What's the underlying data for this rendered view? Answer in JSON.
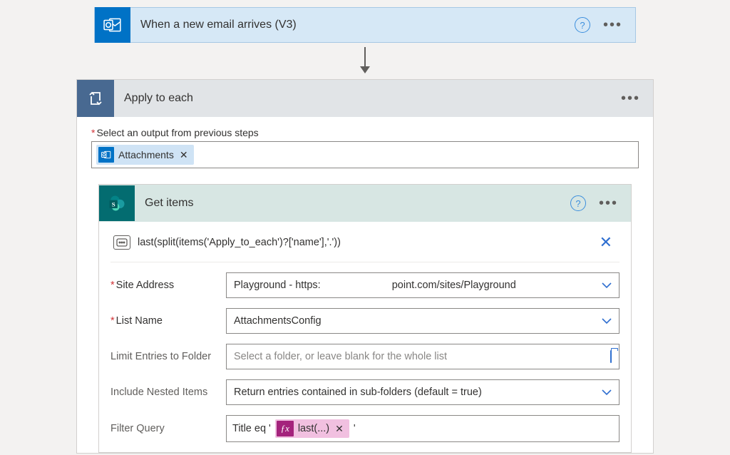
{
  "trigger": {
    "title": "When a new email arrives (V3)"
  },
  "applyToEach": {
    "title": "Apply to each",
    "selectLabel": "Select an output from previous steps",
    "tokenLabel": "Attachments"
  },
  "getItems": {
    "title": "Get items",
    "expression": "last(split(items('Apply_to_each')?['name'],'.'))",
    "fields": {
      "siteAddress": {
        "label": "Site Address",
        "valueLeft": "Playground - https:",
        "valueRight": "point.com/sites/Playground"
      },
      "listName": {
        "label": "List Name",
        "value": "AttachmentsConfig"
      },
      "limitFolder": {
        "label": "Limit Entries to Folder",
        "placeholder": "Select a folder, or leave blank for the whole list"
      },
      "nested": {
        "label": "Include Nested Items",
        "value": "Return entries contained in sub-folders (default = true)"
      },
      "filter": {
        "label": "Filter Query",
        "prefix": "Title eq '",
        "chip": "last(...)",
        "suffix": "'"
      }
    }
  }
}
